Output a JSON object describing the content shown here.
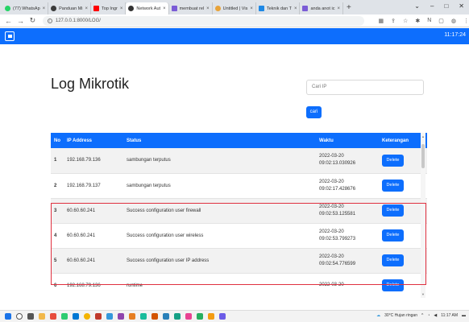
{
  "browser": {
    "tabs": [
      {
        "label": "(77) WhatsAp",
        "color": "#25d366"
      },
      {
        "label": "Panduan Mi",
        "color": "#3b3b3b"
      },
      {
        "label": "Top Ingr",
        "color": "#ff0000"
      },
      {
        "label": "Network Aut",
        "color": "#333333"
      },
      {
        "label": "membuat rel",
        "color": "#7b5cd6"
      },
      {
        "label": "Untitled | Vis",
        "color": "#e8a33a"
      },
      {
        "label": "Teknik dan T",
        "color": "#1e88e5"
      },
      {
        "label": "anda anot ic",
        "color": "#7b5cd6"
      }
    ],
    "new_tab": "+",
    "url": "127.0.0.1:8000/LOG/"
  },
  "app": {
    "time": "11:17:24"
  },
  "main": {
    "title": "Log Mikrotik",
    "search_placeholder": "Cari IP",
    "search_button": "cari"
  },
  "table": {
    "headers": [
      "No",
      "IP Address",
      "Status",
      "Waktu",
      "Keterangan"
    ],
    "rows": [
      {
        "no": "1",
        "ip": "192.168.79.136",
        "status": "sambungan terputus",
        "date": "2022-03-20",
        "time": "09:02:13.030926",
        "action": "Delete"
      },
      {
        "no": "2",
        "ip": "192.168.79.137",
        "status": "sambungan terputus",
        "date": "2022-03-20",
        "time": "09:02:17.428676",
        "action": "Delete"
      },
      {
        "no": "3",
        "ip": "60.60.60.241",
        "status": "Success configuration user firewall",
        "date": "2022-03-20",
        "time": "09:02:53.125581",
        "action": "Delete"
      },
      {
        "no": "4",
        "ip": "60.60.60.241",
        "status": "Success configuration user wireless",
        "date": "2022-03-20",
        "time": "09:02:53.799273",
        "action": "Delete"
      },
      {
        "no": "5",
        "ip": "60.60.60.241",
        "status": "Success configuration user IP address",
        "date": "2022-03-20",
        "time": "09:02:54.776599",
        "action": "Delete"
      },
      {
        "no": "6",
        "ip": "192.168.79.136",
        "status": "runtime",
        "date": "2022-03-20",
        "time": "",
        "action": "Delete"
      }
    ]
  },
  "taskbar": {
    "weather": "30°C Hujan ringan",
    "clock": "11:17 AM"
  },
  "colors": {
    "primary": "#0d6efd",
    "highlight": "#e0303f"
  }
}
